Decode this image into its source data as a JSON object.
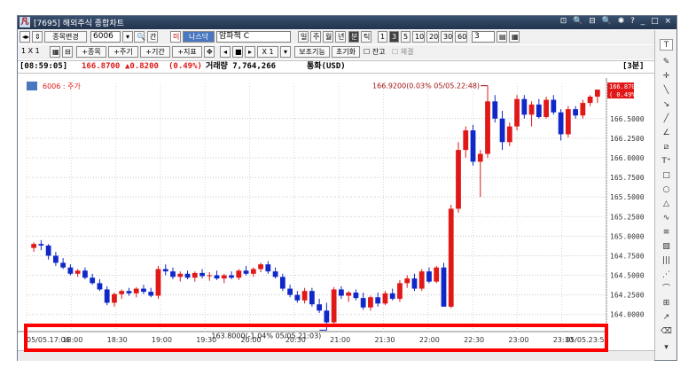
{
  "window": {
    "title": "[7695] 해외주식 종합차트",
    "logo": "凡",
    "controls": "⊡ 🔍 ⊟ 🔍 ✱ ? _ □ ×"
  },
  "toolbar1": {
    "nav": "◂▸",
    "mode_label": "종목변경",
    "code": "6006",
    "buttons": [
      "간",
      "미",
      "나스닥",
      "암파첵 C",
      "일",
      "주",
      "월",
      "년",
      "분",
      "틱",
      "1",
      "3",
      "5",
      "10",
      "20",
      "30",
      "60"
    ],
    "interval_value": "3"
  },
  "toolbar2": {
    "ratio": "1 X 1",
    "buttons": [
      "+종목",
      "+주기",
      "+기간",
      "+지표"
    ],
    "playback": [
      "◂",
      "■",
      "▸",
      "X 1"
    ],
    "settings": [
      "보조기능",
      "초기화"
    ],
    "checks": [
      {
        "label": "잔고",
        "checked": false
      },
      {
        "label": "체결",
        "checked": false
      }
    ]
  },
  "info": {
    "time": "[08:59:05]",
    "price": "166.8700",
    "change": "▲0.8200",
    "change_pct": "(0.49%)",
    "volume": "거래량 7,764,266",
    "currency": "통화(USD)",
    "interval_tag": "[3분]"
  },
  "chart_data": {
    "type": "candlestick",
    "legend": "6006 : 주가",
    "ylim": [
      163.85,
      166.95
    ],
    "yticks": [
      "164.0000",
      "164.2500",
      "164.5000",
      "164.7500",
      "165.0000",
      "165.2500",
      "165.5000",
      "165.7500",
      "166.0000",
      "166.2500",
      "166.5000"
    ],
    "ytick_values": [
      164.0,
      164.25,
      164.5,
      164.75,
      165.0,
      165.25,
      165.5,
      165.75,
      166.0,
      166.25,
      166.5
    ],
    "xticks": [
      "05/05.17:06",
      "18:00",
      "18:30",
      "19:00",
      "19:30",
      "20:00",
      "20:30",
      "21:00",
      "21:30",
      "22:00",
      "22:30",
      "23:00",
      "23:30",
      "05/05.23:51"
    ],
    "last_price_label": "166.8700",
    "last_pct_label": "( 0.49%)",
    "annotations": {
      "high": "166.9200(0.03% 05/05.22:48)",
      "low": "163.8000(-1.04% 05/05.21:03)"
    },
    "series": [
      {
        "name": "",
        "ohlc": [
          [
            164.85,
            164.92,
            164.8,
            164.9
          ],
          [
            164.9,
            164.95,
            164.82,
            164.88
          ],
          [
            164.88,
            164.9,
            164.7,
            164.75
          ],
          [
            164.75,
            164.8,
            164.62,
            164.66
          ],
          [
            164.66,
            164.72,
            164.58,
            164.6
          ],
          [
            164.6,
            164.64,
            164.5,
            164.52
          ],
          [
            164.52,
            164.58,
            164.48,
            164.56
          ],
          [
            164.56,
            164.6,
            164.45,
            164.47
          ],
          [
            164.47,
            164.52,
            164.38,
            164.4
          ],
          [
            164.4,
            164.45,
            164.3,
            164.32
          ],
          [
            164.32,
            164.36,
            164.12,
            164.15
          ],
          [
            164.15,
            164.28,
            164.1,
            164.26
          ],
          [
            164.26,
            164.32,
            164.2,
            164.3
          ],
          [
            164.3,
            164.34,
            164.24,
            164.27
          ],
          [
            164.27,
            164.35,
            164.22,
            164.33
          ],
          [
            164.33,
            164.38,
            164.26,
            164.29
          ],
          [
            164.29,
            164.34,
            164.22,
            164.24
          ],
          [
            164.24,
            164.62,
            164.2,
            164.58
          ],
          [
            164.58,
            164.64,
            164.5,
            164.55
          ],
          [
            164.55,
            164.6,
            164.45,
            164.48
          ],
          [
            164.48,
            164.55,
            164.42,
            164.52
          ],
          [
            164.52,
            164.56,
            164.45,
            164.47
          ],
          [
            164.47,
            164.55,
            164.42,
            164.53
          ],
          [
            164.53,
            164.58,
            164.46,
            164.49
          ],
          [
            164.49,
            164.54,
            164.43,
            164.5
          ],
          [
            164.5,
            164.56,
            164.44,
            164.46
          ],
          [
            164.46,
            164.52,
            164.4,
            164.5
          ],
          [
            164.5,
            164.55,
            164.45,
            164.47
          ],
          [
            164.47,
            164.58,
            164.44,
            164.56
          ],
          [
            164.56,
            164.62,
            164.5,
            164.52
          ],
          [
            164.52,
            164.6,
            164.48,
            164.58
          ],
          [
            164.58,
            164.66,
            164.54,
            164.64
          ],
          [
            164.64,
            164.68,
            164.52,
            164.55
          ],
          [
            164.55,
            164.6,
            164.46,
            164.48
          ],
          [
            164.48,
            164.52,
            164.3,
            164.33
          ],
          [
            164.33,
            164.38,
            164.22,
            164.25
          ],
          [
            164.25,
            164.3,
            164.15,
            164.18
          ],
          [
            164.18,
            164.34,
            164.14,
            164.3
          ],
          [
            164.3,
            164.34,
            164.1,
            164.13
          ],
          [
            164.13,
            164.2,
            164.02,
            164.05
          ],
          [
            164.05,
            164.15,
            163.8,
            163.9
          ],
          [
            163.9,
            164.35,
            163.86,
            164.32
          ],
          [
            164.32,
            164.36,
            164.2,
            164.24
          ],
          [
            164.24,
            164.3,
            164.16,
            164.28
          ],
          [
            164.28,
            164.32,
            164.18,
            164.21
          ],
          [
            164.21,
            164.28,
            164.06,
            164.09
          ],
          [
            164.09,
            164.24,
            164.05,
            164.22
          ],
          [
            164.22,
            164.28,
            164.1,
            164.14
          ],
          [
            164.14,
            164.3,
            164.12,
            164.27
          ],
          [
            164.27,
            164.33,
            164.18,
            164.2
          ],
          [
            164.2,
            164.44,
            164.16,
            164.4
          ],
          [
            164.4,
            164.5,
            164.34,
            164.46
          ],
          [
            164.46,
            164.52,
            164.3,
            164.33
          ],
          [
            164.33,
            164.58,
            164.3,
            164.55
          ],
          [
            164.55,
            164.6,
            164.4,
            164.42
          ],
          [
            164.42,
            164.62,
            164.4,
            164.6
          ],
          [
            164.6,
            164.66,
            164.2,
            164.1
          ],
          [
            164.1,
            165.4,
            164.08,
            165.35
          ],
          [
            165.35,
            166.2,
            165.3,
            166.1
          ],
          [
            166.1,
            166.4,
            166.0,
            166.35
          ],
          [
            166.35,
            166.42,
            165.9,
            165.95
          ],
          [
            165.95,
            166.1,
            165.5,
            166.05
          ],
          [
            166.05,
            166.92,
            166.0,
            166.72
          ],
          [
            166.72,
            166.8,
            166.45,
            166.5
          ],
          [
            166.5,
            166.6,
            166.1,
            166.2
          ],
          [
            166.2,
            166.45,
            166.15,
            166.4
          ],
          [
            166.4,
            166.8,
            166.35,
            166.75
          ],
          [
            166.75,
            166.8,
            166.5,
            166.55
          ],
          [
            166.55,
            166.72,
            166.4,
            166.68
          ],
          [
            166.68,
            166.75,
            166.5,
            166.52
          ],
          [
            166.52,
            166.78,
            166.5,
            166.74
          ],
          [
            166.74,
            166.8,
            166.55,
            166.58
          ],
          [
            166.58,
            166.62,
            166.22,
            166.3
          ],
          [
            166.3,
            166.66,
            166.26,
            166.62
          ],
          [
            166.62,
            166.66,
            166.5,
            166.54
          ],
          [
            166.54,
            166.74,
            166.5,
            166.7
          ],
          [
            166.7,
            166.8,
            166.66,
            166.78
          ],
          [
            166.78,
            166.85,
            166.7,
            166.87
          ]
        ]
      }
    ],
    "colors": {
      "up": "#e01818",
      "down": "#1028c8"
    }
  }
}
